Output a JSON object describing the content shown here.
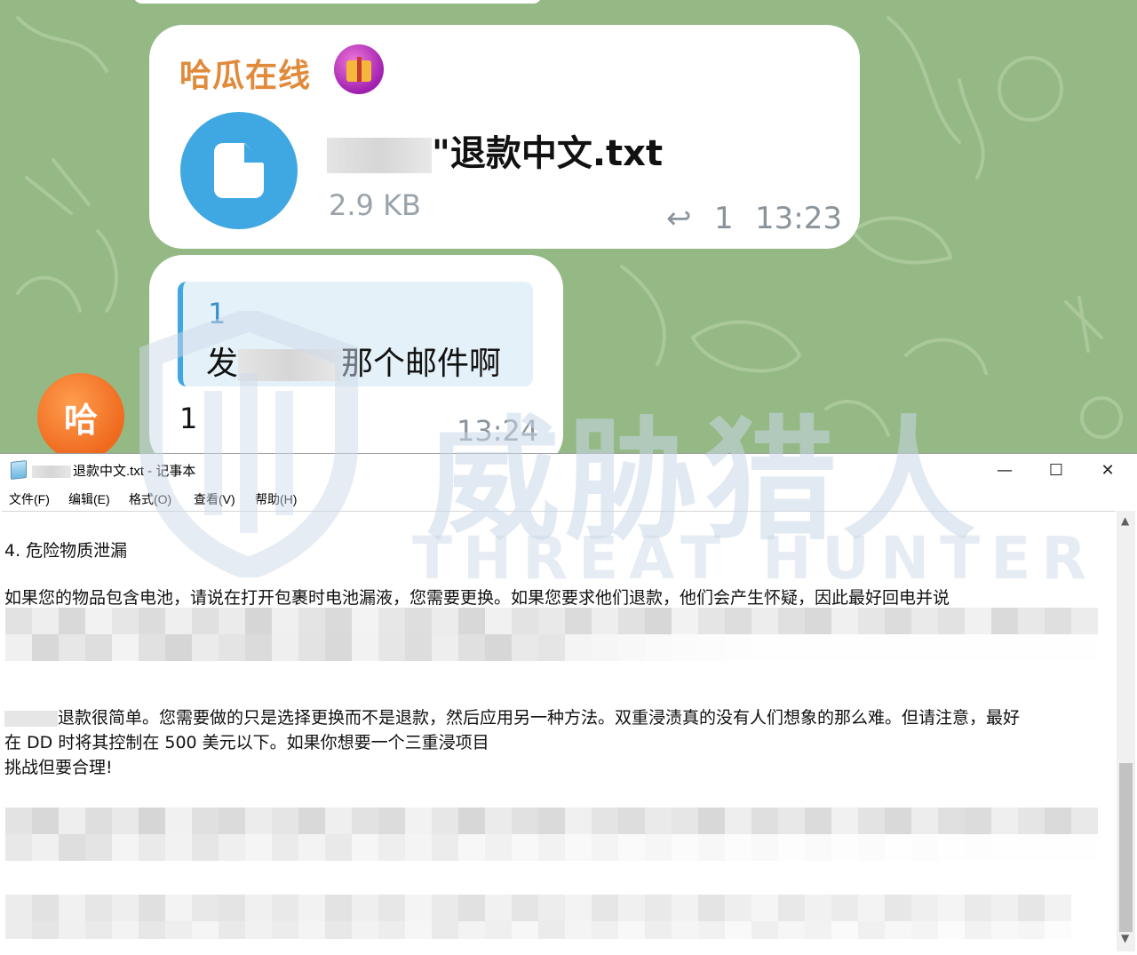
{
  "chat": {
    "message1": {
      "sender": "哈瓜在线",
      "file_name_suffix": "\"退款中文.txt",
      "file_size": "2.9 KB",
      "reply_count": "1",
      "time": "13:23"
    },
    "message2": {
      "quote_author": "1",
      "quote_text_start": "发",
      "quote_text_end": "那个邮件啊",
      "text": "1",
      "time": "13:24"
    },
    "avatar_letter": "哈"
  },
  "notepad": {
    "title_suffix": "退款中文.txt - 记事本",
    "controls": {
      "minimize": "—",
      "maximize": "☐",
      "close": "✕"
    },
    "menu": [
      "文件(F)",
      "编辑(E)",
      "格式(O)",
      "查看(V)",
      "帮助(H)"
    ],
    "lines": {
      "heading": "4. 危险物质泄漏",
      "p1": "如果您的物品包含电池，请说在打开包裹时电池漏液，您需要更换。如果您要求他们退款，他们会产生怀疑，因此最好回电并说",
      "p2a": "退款很简单。您需要做的只是选择更换而不是退款，然后应用另一种方法。双重浸渍真的没有人们想象的那么难。但请注意，最好",
      "p2b": "在 DD 时将其控制在 500 美元以下。如果你想要一个三重浸项目",
      "p2c": "挑战但要合理!"
    }
  },
  "watermark": {
    "cn": "威胁猎人",
    "en": "THREAT HUNTER"
  },
  "colors": {
    "chat_bg": "#94b985",
    "accent_blue": "#3fa7e1",
    "sender_orange": "#e08a3a",
    "avatar_orange": "#ef6a1f"
  }
}
